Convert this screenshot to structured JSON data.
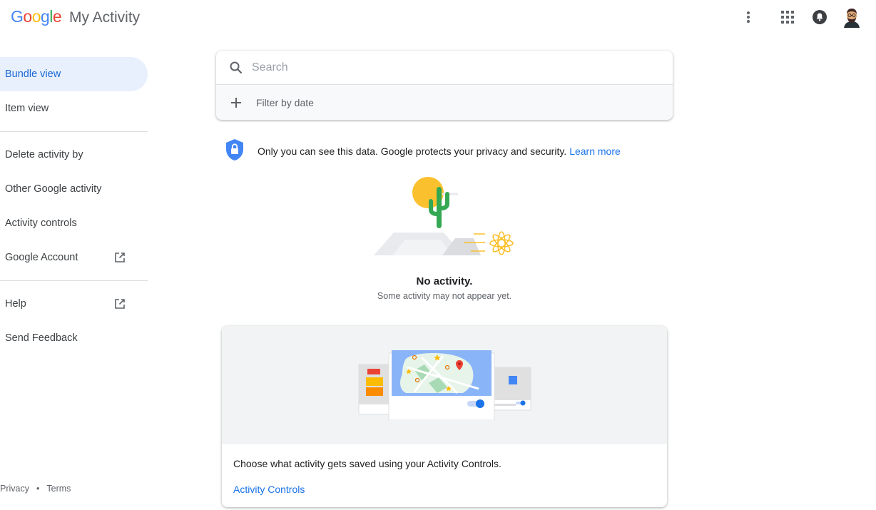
{
  "header": {
    "logo_letters": [
      {
        "ch": "G",
        "color": "#4285F4"
      },
      {
        "ch": "o",
        "color": "#EA4335"
      },
      {
        "ch": "o",
        "color": "#FBBC05"
      },
      {
        "ch": "g",
        "color": "#4285F4"
      },
      {
        "ch": "l",
        "color": "#34A853"
      },
      {
        "ch": "e",
        "color": "#EA4335"
      }
    ],
    "app_name": "My Activity",
    "icons": [
      "more-vert-icon",
      "apps-grid-icon",
      "notifications-icon",
      "avatar"
    ]
  },
  "sidebar": {
    "items": [
      {
        "label": "Bundle view"
      },
      {
        "label": "Item view"
      },
      {
        "label": "Delete activity by"
      },
      {
        "label": "Other Google activity"
      },
      {
        "label": "Activity controls"
      },
      {
        "label": "Google Account"
      },
      {
        "label": "Help"
      },
      {
        "label": "Send Feedback"
      }
    ],
    "active_index": 0
  },
  "footer": {
    "privacy": "Privacy",
    "separator": "•",
    "terms": "Terms"
  },
  "search": {
    "placeholder": "Search",
    "value": "",
    "filter_label": "Filter by date"
  },
  "privacy_notice": {
    "text": "Only you can see this data. Google protects your privacy and security.",
    "link": "Learn more"
  },
  "empty_state": {
    "title": "No activity.",
    "subtitle": "Some activity may not appear yet."
  },
  "activity_card": {
    "text": "Choose what activity gets saved using your Activity Controls.",
    "link": "Activity Controls"
  },
  "colors": {
    "accent": "#1a73e8",
    "active_bg": "#e8f0fe",
    "active_text": "#1967d2"
  }
}
